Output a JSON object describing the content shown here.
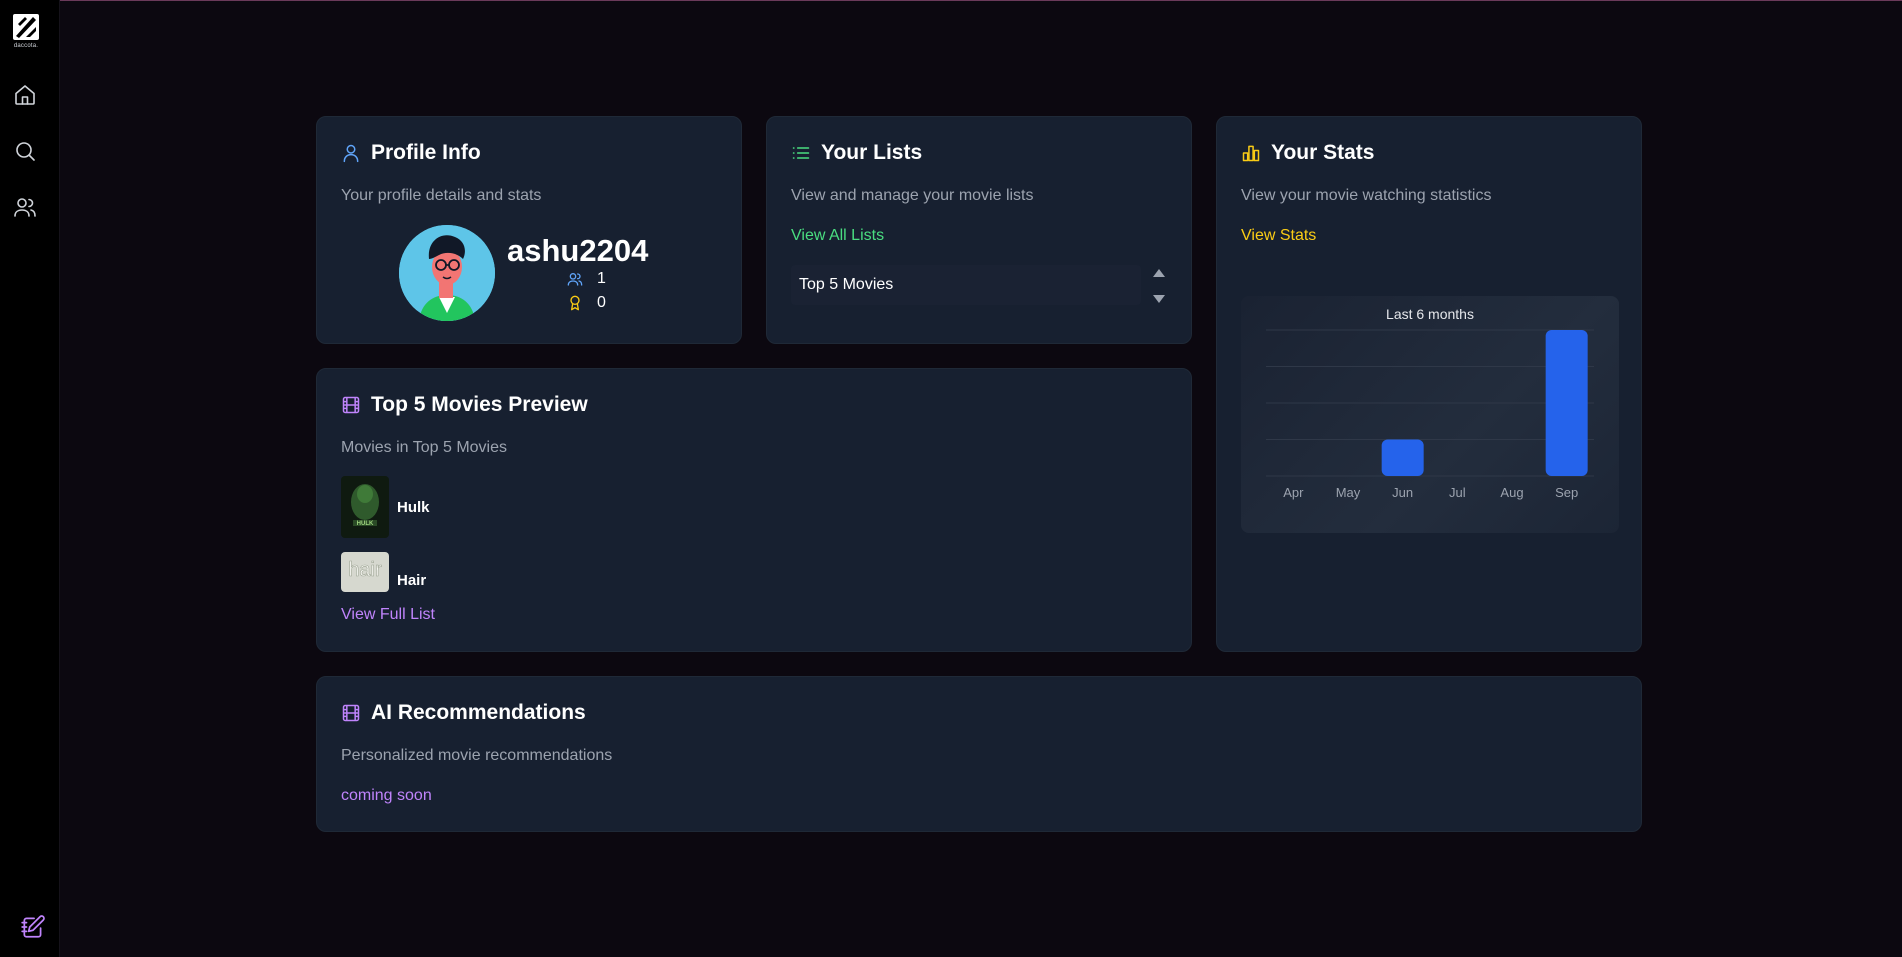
{
  "brand": {
    "logo_text": "daccota."
  },
  "sidebar": {
    "items": [
      {
        "name": "home",
        "icon": "home-icon"
      },
      {
        "name": "search",
        "icon": "search-icon"
      },
      {
        "name": "friends",
        "icon": "users-icon"
      }
    ],
    "bottom_icon": "edit-notebook-icon"
  },
  "profile": {
    "title": "Profile Info",
    "subtitle": "Your profile details and stats",
    "username": "ashu2204",
    "followers": "1",
    "awards": "0",
    "icon": "user-icon"
  },
  "lists": {
    "title": "Your Lists",
    "subtitle": "View and manage your movie lists",
    "view_all_label": "View All Lists",
    "selected_list": "Top 5 Movies",
    "icon": "list-icon"
  },
  "stats": {
    "title": "Your Stats",
    "subtitle": "View your movie watching statistics",
    "view_label": "View Stats",
    "icon": "bar-chart-icon"
  },
  "preview": {
    "title": "Top 5 Movies Preview",
    "subtitle": "Movies in Top 5 Movies",
    "movies": [
      {
        "title": "Hulk",
        "poster_text": "HULK"
      },
      {
        "title": "Hair",
        "poster_text": "hair"
      }
    ],
    "view_full_label": "View Full List",
    "icon": "film-icon"
  },
  "ai": {
    "title": "AI Recommendations",
    "subtitle": "Personalized movie recommendations",
    "status": "coming soon",
    "icon": "film-icon"
  },
  "colors": {
    "accent_green": "#4ade80",
    "accent_yellow": "#facc15",
    "accent_purple": "#c084fc",
    "accent_blue": "#60a5fa",
    "bar_blue": "#2563eb",
    "card_bg": "#172030"
  },
  "chart_data": {
    "type": "bar",
    "title": "Last 6 months",
    "categories": [
      "Apr",
      "May",
      "Jun",
      "Jul",
      "Aug",
      "Sep"
    ],
    "values": [
      0,
      0,
      1,
      0,
      0,
      4
    ],
    "ylim": [
      0,
      4
    ],
    "grid": true,
    "legend": "none",
    "xlabel": "",
    "ylabel": ""
  }
}
